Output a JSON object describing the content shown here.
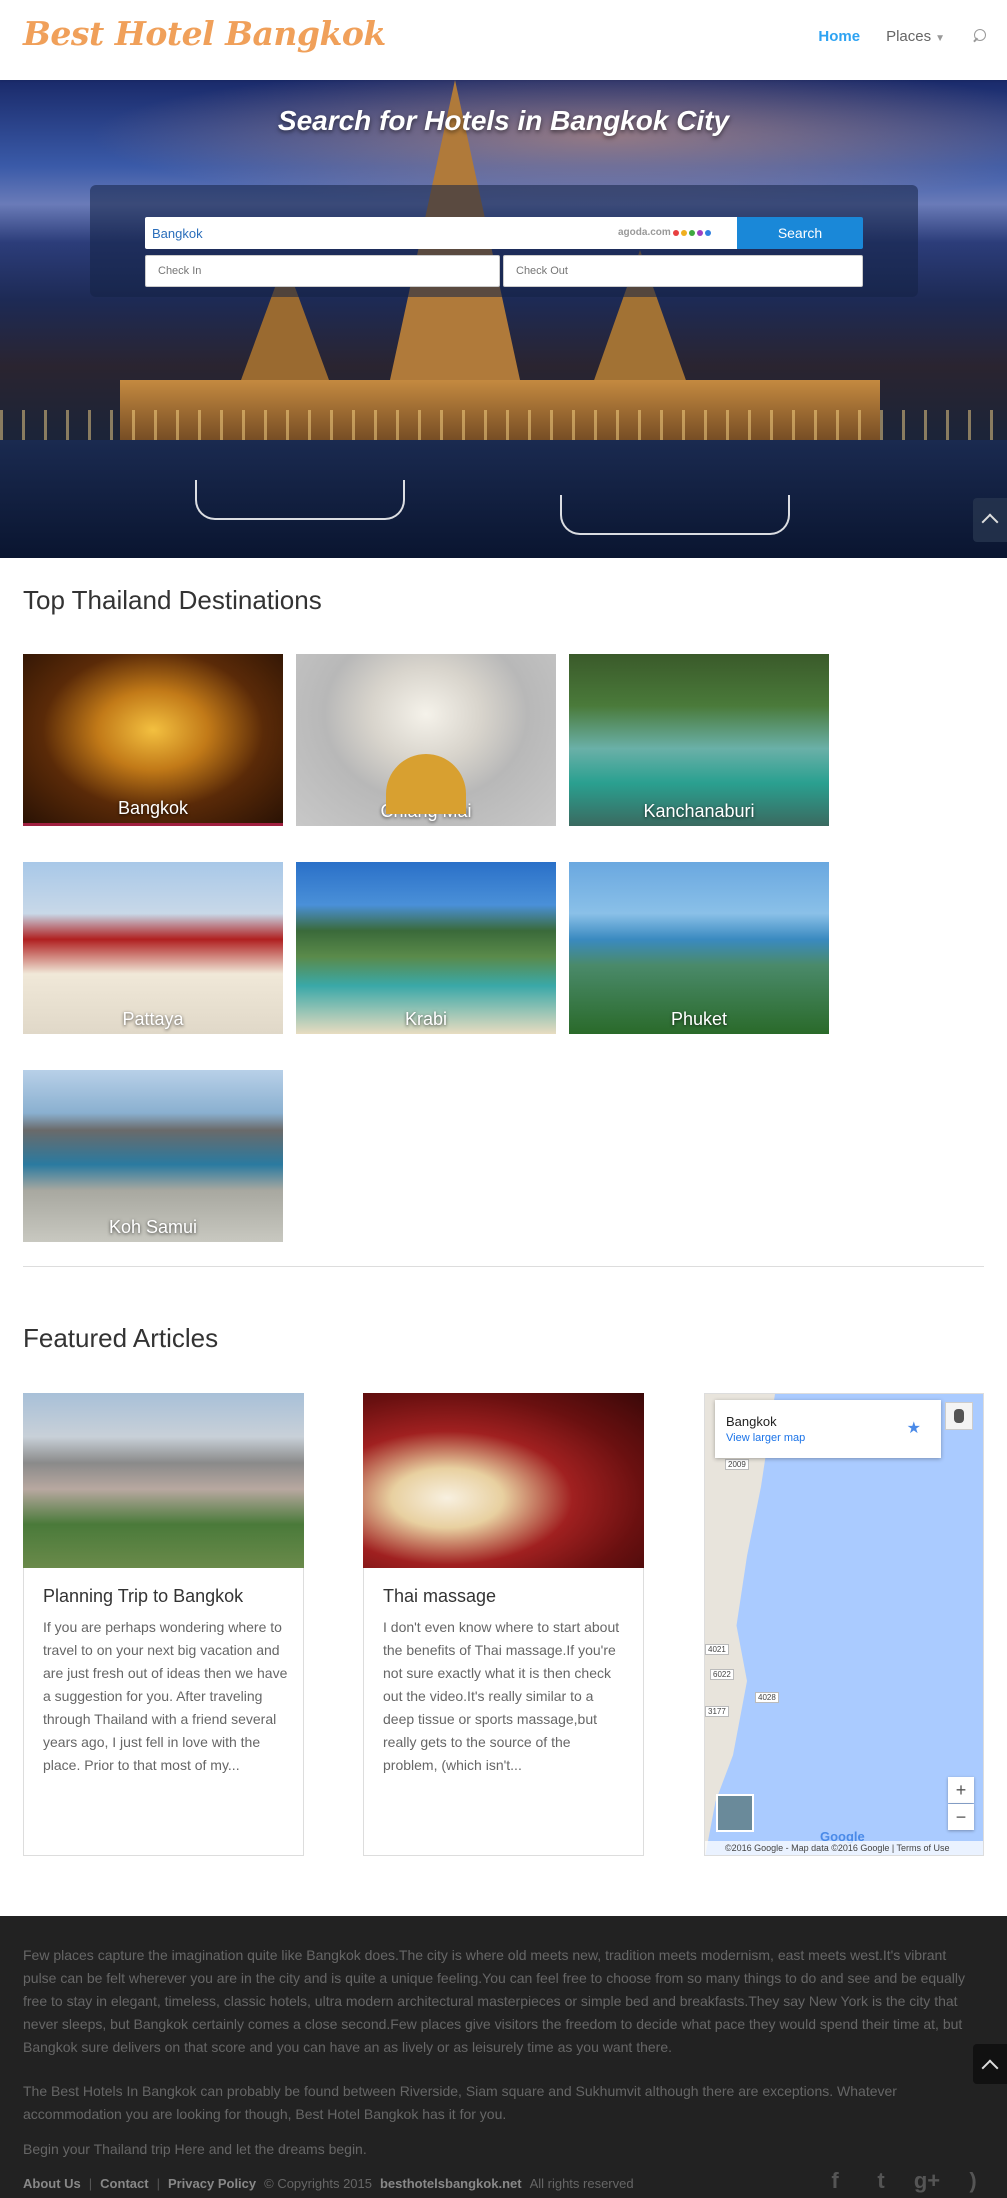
{
  "header": {
    "logo": "Best Hotel Bangkok",
    "nav": {
      "home": "Home",
      "places": "Places"
    }
  },
  "hero": {
    "title": "Search for Hotels in Bangkok City",
    "search_value": "Bangkok",
    "agoda": "agoda.com",
    "search_button": "Search",
    "check_in": "Check In",
    "check_out": "Check Out"
  },
  "destinations": {
    "title": "Top Thailand Destinations",
    "items": [
      {
        "label": "Bangkok"
      },
      {
        "label": "Chiang Mai"
      },
      {
        "label": "Kanchanaburi"
      },
      {
        "label": "Pattaya"
      },
      {
        "label": "Krabi"
      },
      {
        "label": "Phuket"
      },
      {
        "label": "Koh Samui"
      }
    ]
  },
  "articles": {
    "title": "Featured Articles",
    "items": [
      {
        "title": "Planning Trip to Bangkok",
        "excerpt": "If you are perhaps wondering where to travel to on your next big vacation and are just fresh out of ideas then we have a suggestion for you. After traveling through Thailand with a friend several years ago, I just fell in love with the place. Prior to that most of my..."
      },
      {
        "title": "Thai massage",
        "excerpt": "I don't even know where to start about the benefits of Thai massage.If you're not sure exactly what it is then check out the video.It's really similar to a deep tissue or sports massage,but really gets to the source of the problem, (which isn't..."
      }
    ]
  },
  "map": {
    "place": "Bangkok",
    "link": "View larger map",
    "roads": [
      "2009",
      "4021",
      "6022",
      "4028",
      "3177"
    ],
    "zoom_in": "+",
    "zoom_out": "−",
    "logo": "Google",
    "attribution": "©2016 Google - Map data ©2016 Google | Terms of Use"
  },
  "footer": {
    "p1": "Few places capture the imagination quite like Bangkok does.The city is where old meets new, tradition meets modernism, east meets west.It's vibrant pulse can be felt wherever you are in the city and is quite a unique feeling.You can feel free to choose from so many things to do and see and be equally free to stay in elegant, timeless, classic hotels, ultra modern architectural masterpieces or simple bed and breakfasts.They say New York is the city that never sleeps, but Bangkok certainly comes a close second.Few places give visitors the freedom to decide what pace they would spend their time at, but Bangkok sure delivers on that score and you can have an as lively or as leisurely time as you want there.",
    "p2": "The Best Hotels In Bangkok can probably be found between Riverside, Siam square and Sukhumvit although there are exceptions. Whatever accommodation you are looking for though, Best Hotel Bangkok has it for you.",
    "p3": "Begin your Thailand trip Here and let the dreams begin.",
    "links": {
      "about": "About Us",
      "contact": "Contact",
      "privacy": "Privacy Policy"
    },
    "copyright_prefix": "© Copyrights 2015",
    "site": "besthotelsbangkok.net",
    "copyright_suffix": "All rights reserved",
    "social": [
      "facebook",
      "twitter",
      "google-plus",
      "rss"
    ]
  }
}
